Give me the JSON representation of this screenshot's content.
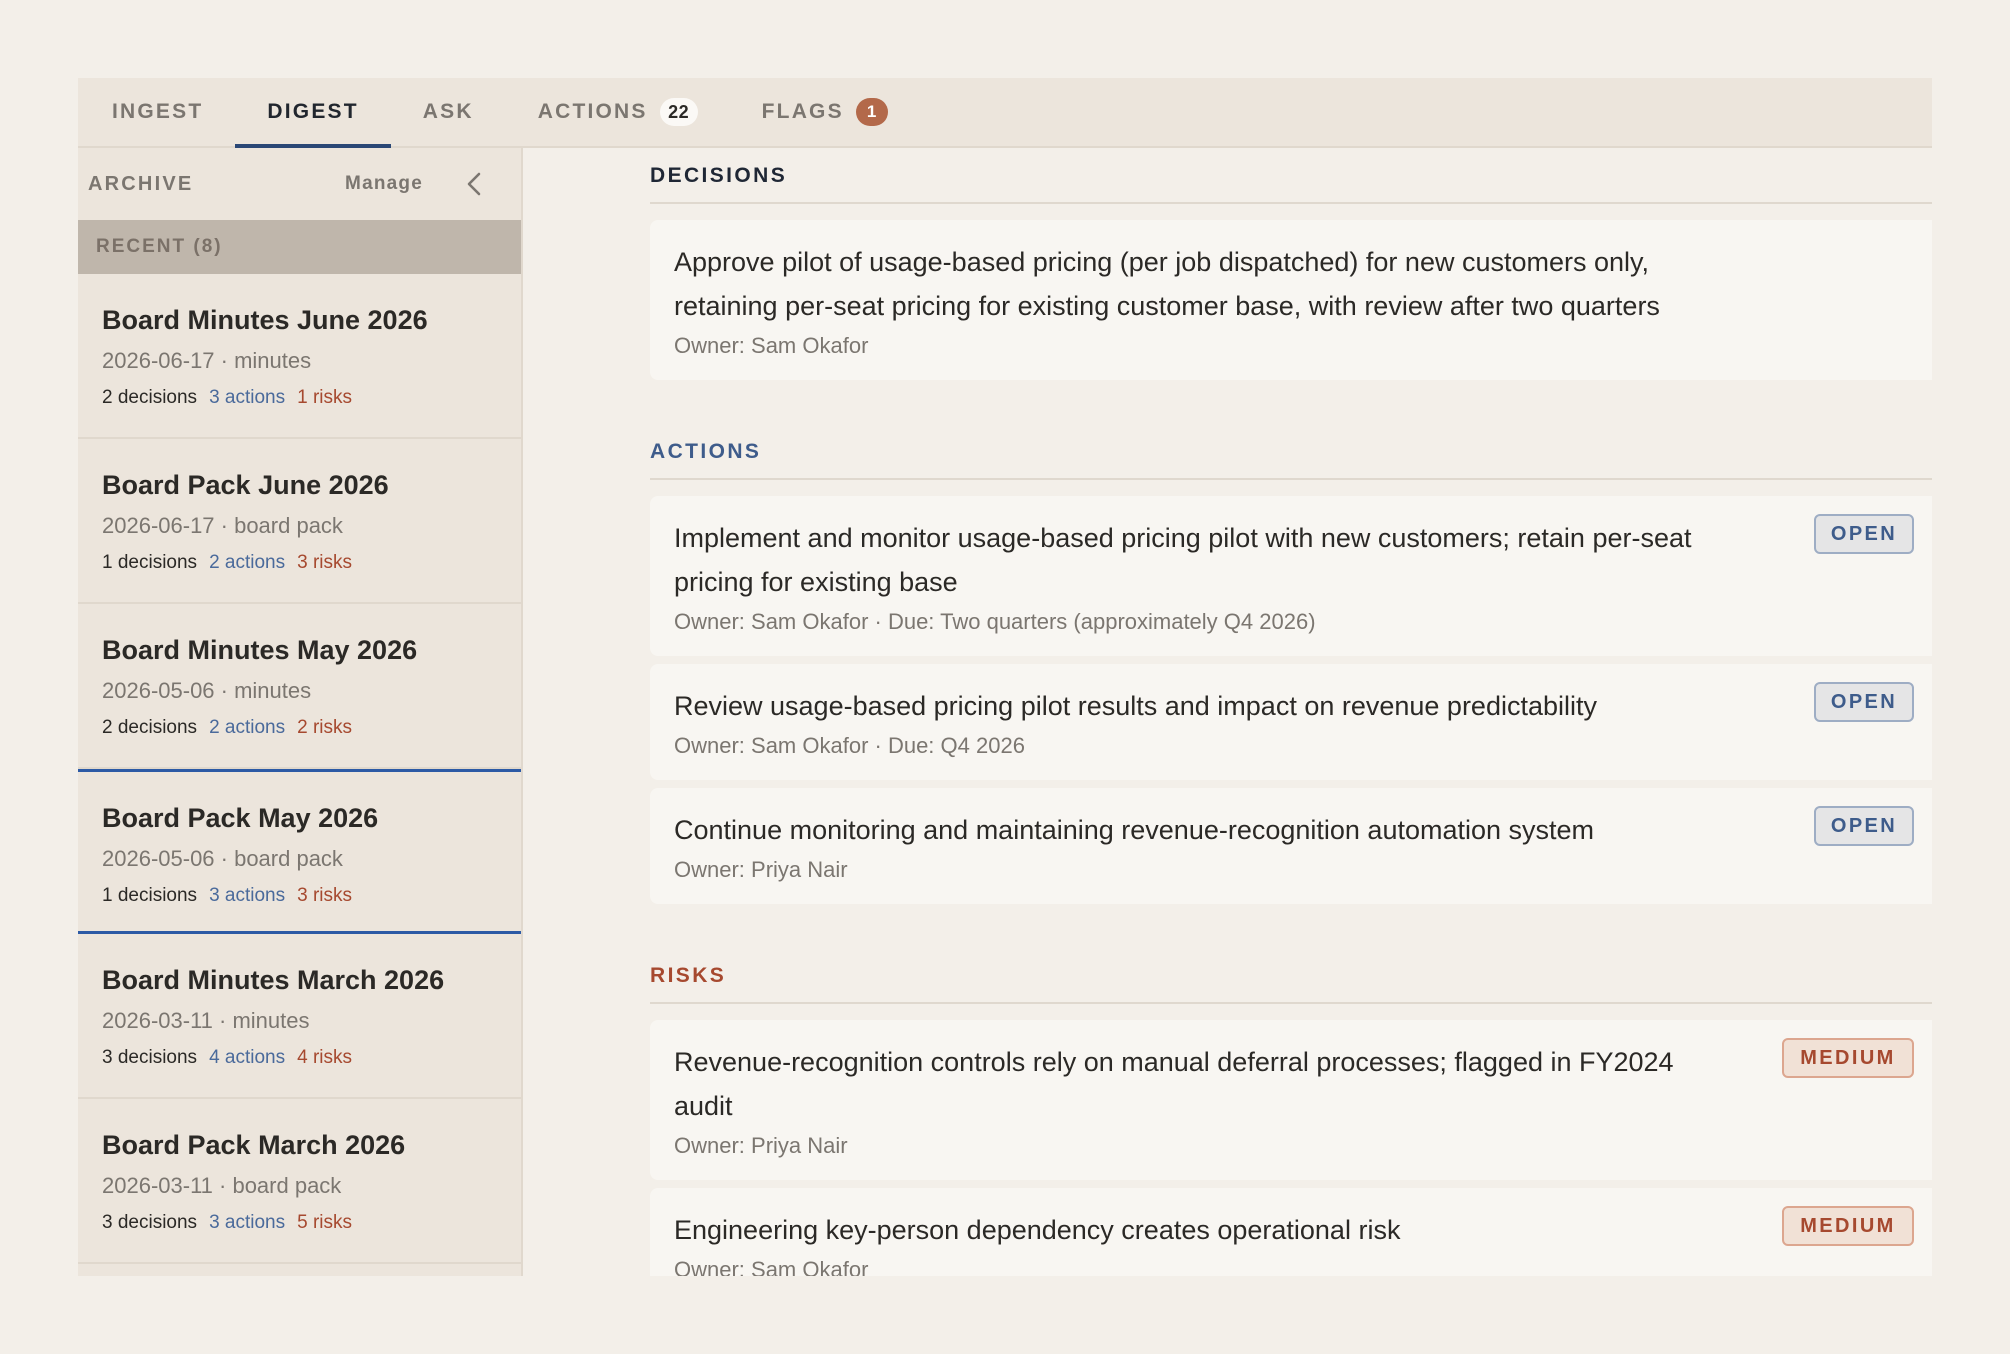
{
  "tabs": [
    {
      "label": "INGEST",
      "badge": ""
    },
    {
      "label": "DIGEST",
      "badge": ""
    },
    {
      "label": "ASK",
      "badge": ""
    },
    {
      "label": "ACTIONS",
      "badge": "22"
    },
    {
      "label": "FLAGS",
      "badge": "1"
    }
  ],
  "sidebar": {
    "title": "ARCHIVE",
    "manage_label": "Manage",
    "section_label": "RECENT (8)",
    "docs": [
      {
        "title": "Board Minutes June 2026",
        "meta": "2026-06-17 · minutes",
        "decisions": "2 decisions",
        "actions": "3 actions",
        "risks": "1 risks"
      },
      {
        "title": "Board Pack June 2026",
        "meta": "2026-06-17 · board pack",
        "decisions": "1 decisions",
        "actions": "2 actions",
        "risks": "3 risks"
      },
      {
        "title": "Board Minutes May 2026",
        "meta": "2026-05-06 · minutes",
        "decisions": "2 decisions",
        "actions": "2 actions",
        "risks": "2 risks"
      },
      {
        "title": "Board Pack May 2026",
        "meta": "2026-05-06 · board pack",
        "decisions": "1 decisions",
        "actions": "3 actions",
        "risks": "3 risks"
      },
      {
        "title": "Board Minutes March 2026",
        "meta": "2026-03-11 · minutes",
        "decisions": "3 decisions",
        "actions": "4 actions",
        "risks": "4 risks"
      },
      {
        "title": "Board Pack March 2026",
        "meta": "2026-03-11 · board pack",
        "decisions": "3 decisions",
        "actions": "3 actions",
        "risks": "5 risks"
      }
    ]
  },
  "main": {
    "decisions": {
      "title": "DECISIONS",
      "items": [
        {
          "text": "Approve pilot of usage-based pricing (per job dispatched) for new customers only, retaining per-seat pricing for existing customer base, with review after two quarters",
          "owner": "Owner: Sam Okafor"
        }
      ]
    },
    "actions": {
      "title": "ACTIONS",
      "items": [
        {
          "text": "Implement and monitor usage-based pricing pilot with new customers; retain per-seat pricing for existing base",
          "owner": "Owner: Sam Okafor · Due: Two quarters (approximately Q4 2026)",
          "status": "OPEN"
        },
        {
          "text": "Review usage-based pricing pilot results and impact on revenue predictability",
          "owner": "Owner: Sam Okafor · Due: Q4 2026",
          "status": "OPEN"
        },
        {
          "text": "Continue monitoring and maintaining revenue-recognition automation system",
          "owner": "Owner: Priya Nair",
          "status": "OPEN"
        }
      ]
    },
    "risks": {
      "title": "RISKS",
      "items": [
        {
          "text": "Revenue-recognition controls rely on manual deferral processes; flagged in FY2024 audit",
          "owner": "Owner: Priya Nair",
          "severity": "MEDIUM"
        },
        {
          "text": "Engineering key-person dependency creates operational risk",
          "owner": "Owner: Sam Okafor",
          "severity": "MEDIUM"
        }
      ]
    }
  },
  "colors": {
    "accent": "#2a4775",
    "selected_border": "#2c5aa5",
    "action_blue": "#3e5c8b",
    "risk_red": "#a6492f",
    "flag_badge": "#b3694a"
  }
}
